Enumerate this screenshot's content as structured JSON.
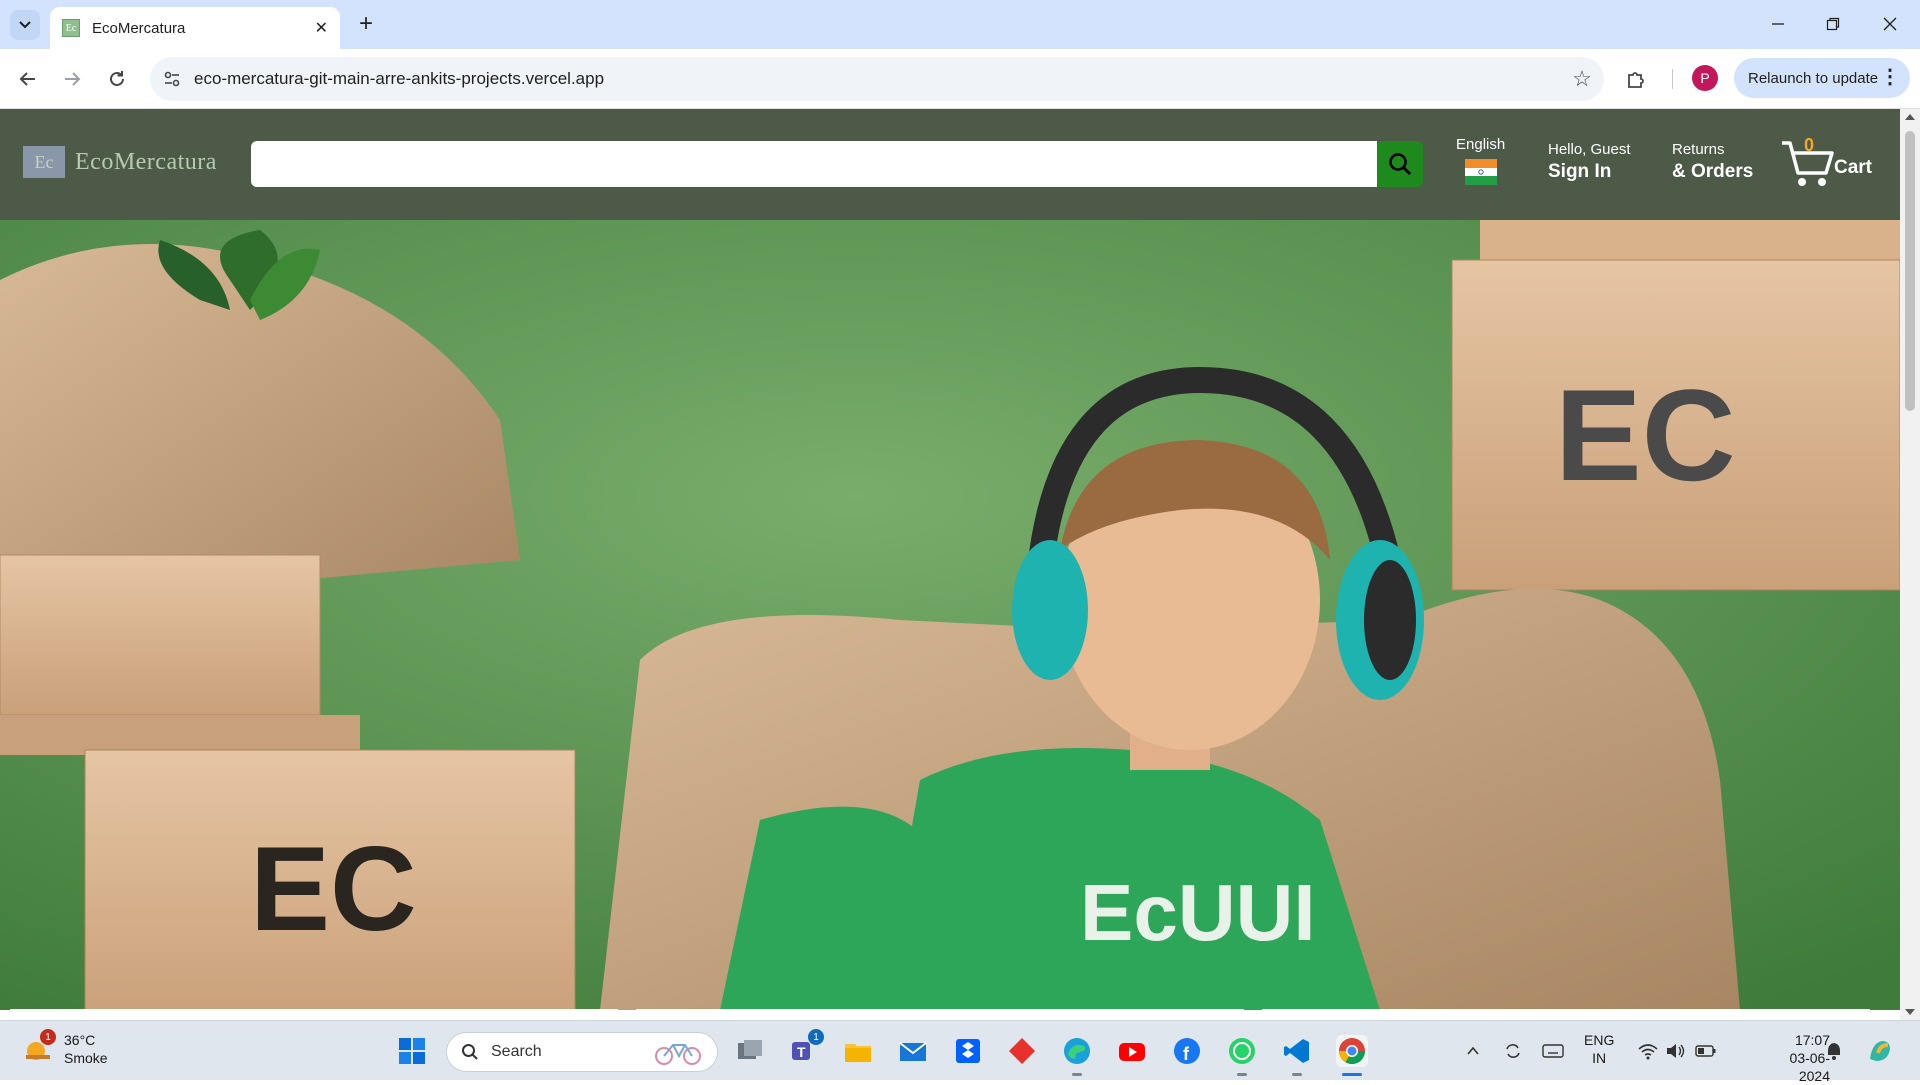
{
  "browser": {
    "tab_title": "EcoMercatura",
    "favicon_text": "Ec",
    "url": "eco-mercatura-git-main-arre-ankits-projects.vercel.app",
    "relaunch_label": "Relaunch to update",
    "profile_initial": "P"
  },
  "site": {
    "logo_mark": "Ec",
    "logo_text": "EcoMercatura",
    "search_placeholder": "",
    "language_label": "English",
    "greeting": "Hello, Guest",
    "sign_in": "Sign In",
    "returns_label": "Returns",
    "orders_label": "& Orders",
    "cart_count": "0",
    "cart_label": "Cart",
    "colors": {
      "header_bg": "#4c5a47",
      "search_button": "#1e8a1e",
      "cart_count": "#f5a623",
      "hero_bg": "#5f9a54"
    }
  },
  "hero": {
    "box_text_right": "EC",
    "box_text_left": "EC",
    "shirt_text": "EcUUI"
  },
  "taskbar": {
    "weather_temp": "36°C",
    "weather_desc": "Smoke",
    "weather_badge": "1",
    "search_label": "Search",
    "teams_badge": "1",
    "lang_top": "ENG",
    "lang_bottom": "IN",
    "time": "17:07",
    "date": "03-06-2024"
  }
}
